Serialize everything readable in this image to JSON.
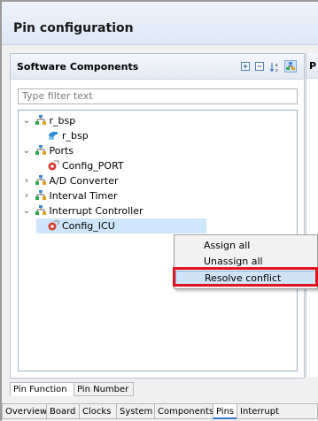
{
  "header": {
    "title": "Pin configuration"
  },
  "software_components": {
    "title": "Software Components",
    "toolbar": {
      "icons": [
        "expand-all-icon",
        "collapse-all-icon",
        "sort-az-icon",
        "component-view-icon"
      ]
    },
    "filter": {
      "value": "",
      "placeholder": "Type filter text"
    },
    "tree": [
      {
        "label": "r_bsp",
        "expanded": true,
        "type": "group"
      },
      {
        "label": "r_bsp",
        "type": "module"
      },
      {
        "label": "Ports",
        "expanded": true,
        "type": "group"
      },
      {
        "label": "Config_PORT",
        "type": "config"
      },
      {
        "label": "A/D Converter",
        "expanded": false,
        "type": "group"
      },
      {
        "label": "Interval Timer",
        "expanded": false,
        "type": "group"
      },
      {
        "label": "Interrupt Controller",
        "expanded": true,
        "type": "group"
      },
      {
        "label": "Config_ICU",
        "type": "config",
        "selected": true
      }
    ]
  },
  "right_panel": {
    "title_fragment": "P"
  },
  "context_menu": {
    "items": [
      "Assign all",
      "Unassign all",
      "Resolve conflict"
    ],
    "highlighted": "Resolve conflict"
  },
  "sub_tabs": {
    "items": [
      "Pin Function",
      "Pin Number"
    ],
    "active": "Pin Function"
  },
  "main_tabs": {
    "items": [
      "Overview",
      "Board",
      "Clocks",
      "System",
      "Components",
      "Pins",
      "Interrupt"
    ],
    "active": "Pins"
  },
  "colors": {
    "highlight_border": "#e0141e",
    "selection": "#cde6fb",
    "menu_hover": "#cfe3f8"
  }
}
